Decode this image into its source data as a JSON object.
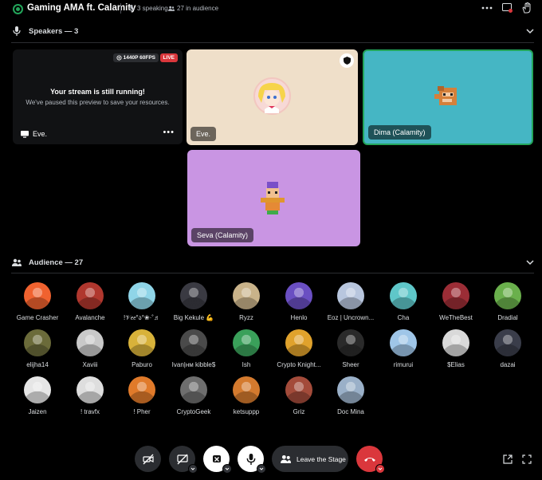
{
  "header": {
    "title": "Gaming AMA ft. Calamity",
    "speaking": "3 speaking",
    "audience_count": "27 in audience"
  },
  "speakers_section": {
    "label": "Speakers — 3"
  },
  "stream_tile": {
    "badge_quality": "1440P 60FPS",
    "badge_live": "LIVE",
    "message_title": "Your stream is still running!",
    "message_body": "We've paused this preview to save your resources.",
    "streamer_name": "Eve."
  },
  "speaker_tiles": [
    {
      "name": "Eve.",
      "bg": "#efdfc9"
    },
    {
      "name": "Dima (Calamity)",
      "bg": "#45b6c4"
    },
    {
      "name": "Seva (Calamity)",
      "bg": "#c995e3"
    }
  ],
  "audience_section": {
    "label": "Audience — 27"
  },
  "audience": [
    {
      "name": "Game Crasher",
      "color": "#f0622f"
    },
    {
      "name": "Avalanche",
      "color": "#b0372e"
    },
    {
      "name": "!𝒱𝑒𝑒°ა°❀·˚♬",
      "color": "#8fd5e8"
    },
    {
      "name": "Big Kekule 💪",
      "color": "#3a3a42"
    },
    {
      "name": "Ryzz",
      "color": "#c9b38a"
    },
    {
      "name": "Henlo",
      "color": "#6a4fc2"
    },
    {
      "name": "Eoz | Uncrown...",
      "color": "#b8c6de"
    },
    {
      "name": "Cha",
      "color": "#5fc7c9"
    },
    {
      "name": "WeTheBest",
      "color": "#9b2d36"
    },
    {
      "name": "Dradial",
      "color": "#6ab04c"
    },
    {
      "name": "elijha14",
      "color": "#6b6b3a"
    },
    {
      "name": "Xaviii",
      "color": "#c9c9c9"
    },
    {
      "name": "Paburo",
      "color": "#d8b23a"
    },
    {
      "name": "Ivan|нм kibble$",
      "color": "#4a4a4a"
    },
    {
      "name": "Ish",
      "color": "#3aa05a"
    },
    {
      "name": "Crypto Knight...",
      "color": "#e0a22c"
    },
    {
      "name": "Sheer",
      "color": "#2a2a2a"
    },
    {
      "name": "rimurui",
      "color": "#9fc6e8"
    },
    {
      "name": "$Elias",
      "color": "#d9d9d9"
    },
    {
      "name": "dazai",
      "color": "#3a3d4a"
    },
    {
      "name": "Jaizen",
      "color": "#e6e6e6"
    },
    {
      "name": "! travfx",
      "color": "#dedede"
    },
    {
      "name": "! Pher",
      "color": "#e07a2a"
    },
    {
      "name": "CryptoGeek",
      "color": "#6e6e6e"
    },
    {
      "name": "ketsuppp",
      "color": "#d47a2e"
    },
    {
      "name": "Griz",
      "color": "#a34b3a"
    },
    {
      "name": "Doc Mina",
      "color": "#9ab0c8"
    }
  ],
  "controls": {
    "leave_label": "Leave the Stage"
  },
  "colors": {
    "accent_green": "#23a55a",
    "live_red": "#da373c",
    "end_red": "#da373c"
  }
}
